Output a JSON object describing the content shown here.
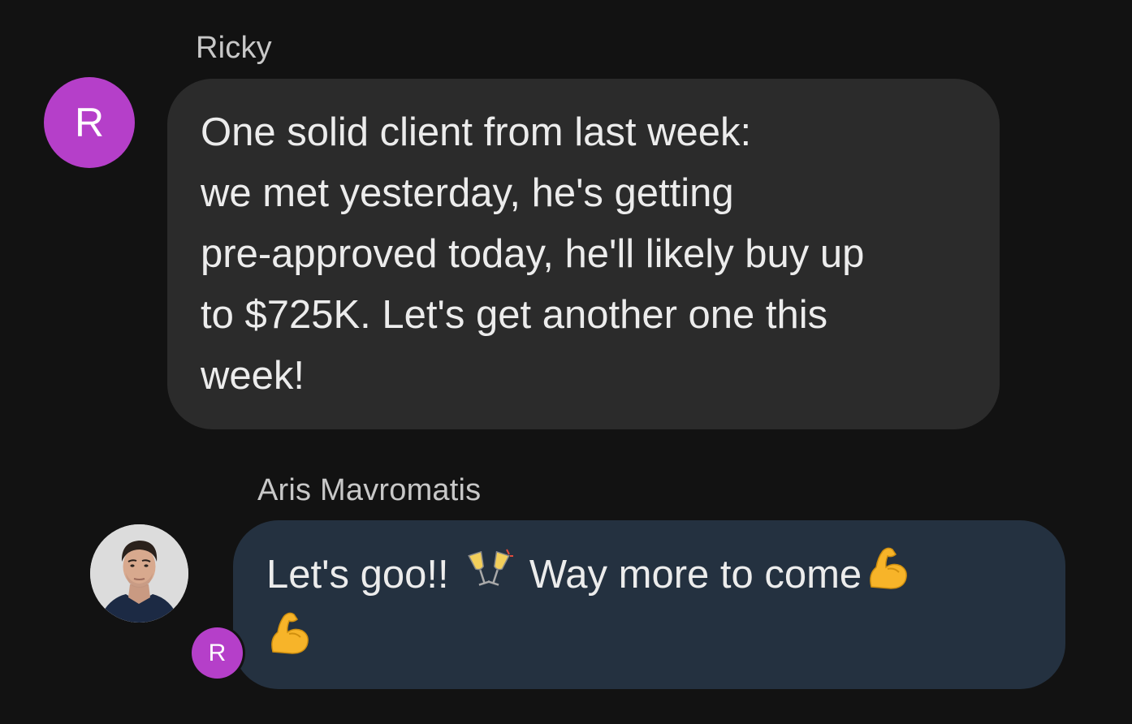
{
  "messages": [
    {
      "sender": "Ricky",
      "avatar_letter": "R",
      "lines": [
        "One solid client from last week:",
        "we met yesterday, he's getting",
        "pre-approved today, he'll likely buy up",
        "to $725K. Let's get another one this",
        "week!"
      ]
    },
    {
      "sender": "Aris Mavromatis",
      "avatar": "profile-photo",
      "text_part1": "Let's goo!!",
      "emoji_1": "clinking-glasses-icon",
      "text_part2": "Way more to come",
      "emoji_2": "flexed-biceps-icon",
      "emoji_3": "flexed-biceps-icon",
      "read_receipt_letter": "R"
    }
  ],
  "colors": {
    "background": "#121212",
    "incoming_bubble": "#2b2b2b",
    "outgoing_bubble": "#243140",
    "avatar_accent": "#b53fc9"
  }
}
